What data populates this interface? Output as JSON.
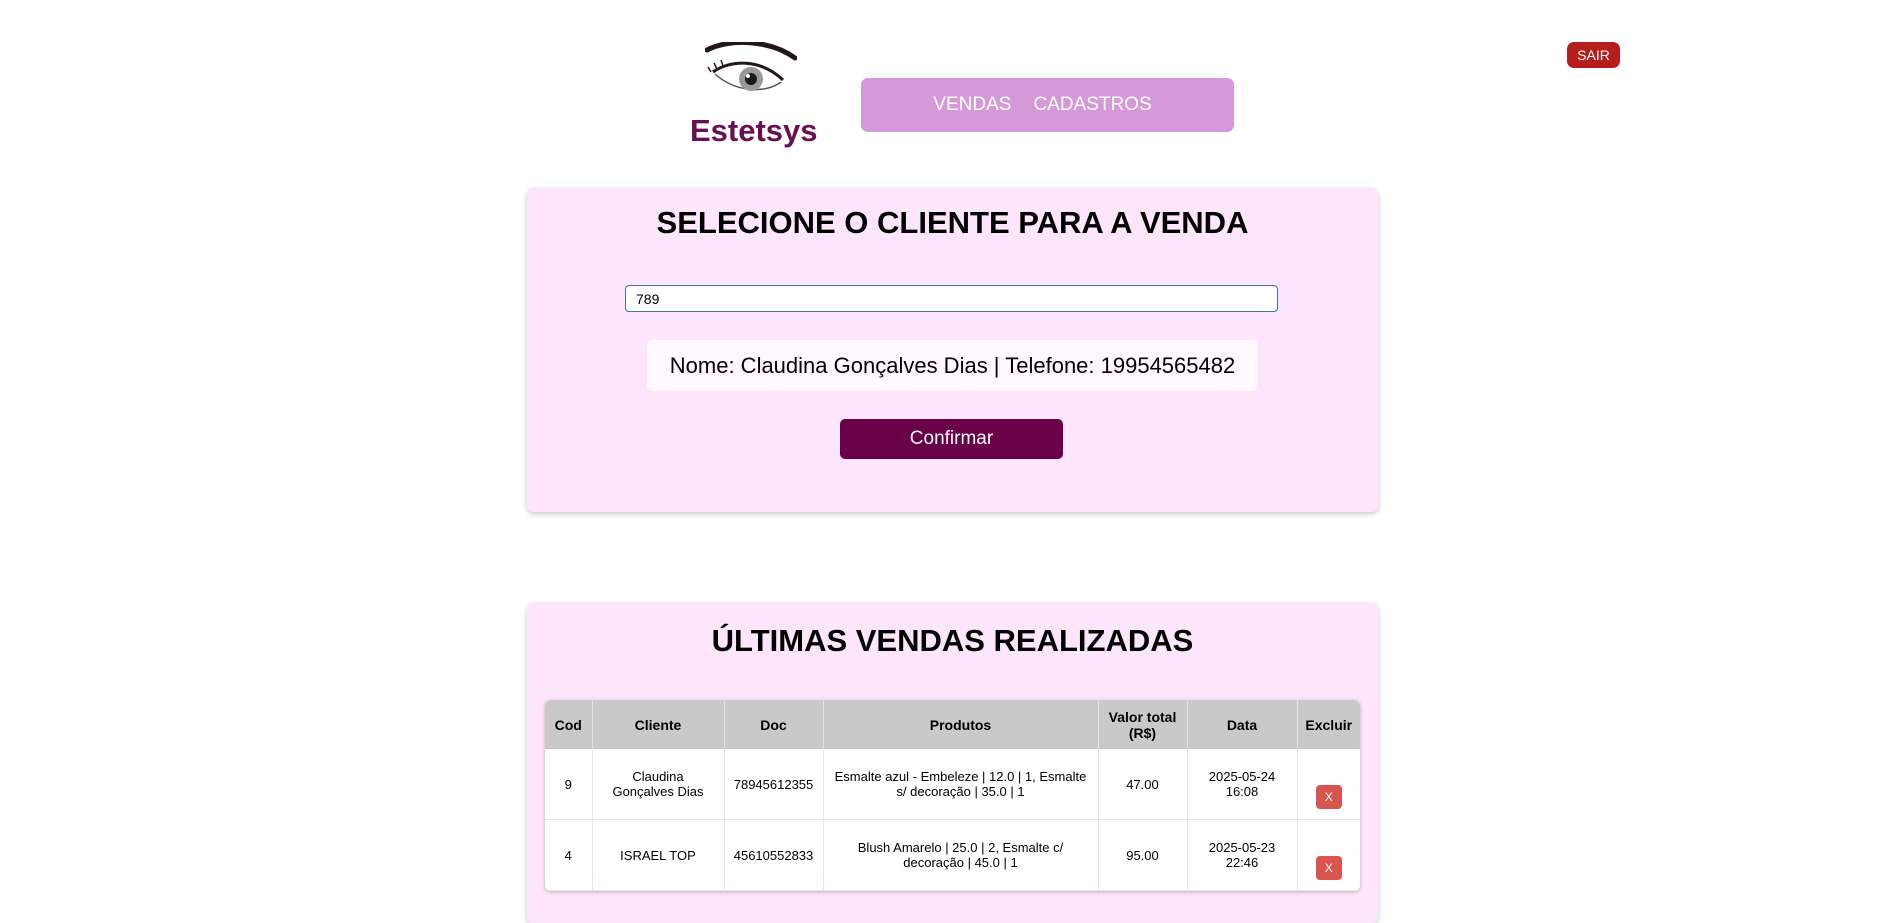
{
  "header": {
    "brand": "Estetsys",
    "logo_icon": "eye-lash-icon",
    "nav": [
      {
        "label": "VENDAS"
      },
      {
        "label": "CADASTROS"
      }
    ],
    "logout_label": "SAIR"
  },
  "client_select": {
    "title": "SELECIONE O CLIENTE PARA A VENDA",
    "search_value": "789",
    "result_text": "Nome: Claudina Gonçalves Dias | Telefone: 19954565482",
    "confirm_label": "Confirmar"
  },
  "recent_sales": {
    "title": "ÚLTIMAS VENDAS REALIZADAS",
    "columns": [
      "Cod",
      "Cliente",
      "Doc",
      "Produtos",
      "Valor total (R$)",
      "Data",
      "Excluir"
    ],
    "rows": [
      {
        "cod": "9",
        "cliente": "Claudina Gonçalves Dias",
        "doc": "78945612355",
        "produtos": "Esmalte azul - Embeleze | 12.0 | 1, Esmalte s/ decoração | 35.0 | 1",
        "valor": "47.00",
        "data": "2025-05-24 16:08",
        "excluir": "X"
      },
      {
        "cod": "4",
        "cliente": "ISRAEL TOP",
        "doc": "45610552833",
        "produtos": "Blush Amarelo | 25.0 | 2, Esmalte c/ decoração | 45.0 | 1",
        "valor": "95.00",
        "data": "2025-05-23 22:46",
        "excluir": "X"
      }
    ]
  },
  "colors": {
    "brand": "#6a0f52",
    "nav_bg": "#d598d8",
    "card_bg": "#fde6fb",
    "confirm_bg": "#6a0047",
    "logout_bg": "#b51d1d",
    "delete_bg": "#d9534f"
  }
}
